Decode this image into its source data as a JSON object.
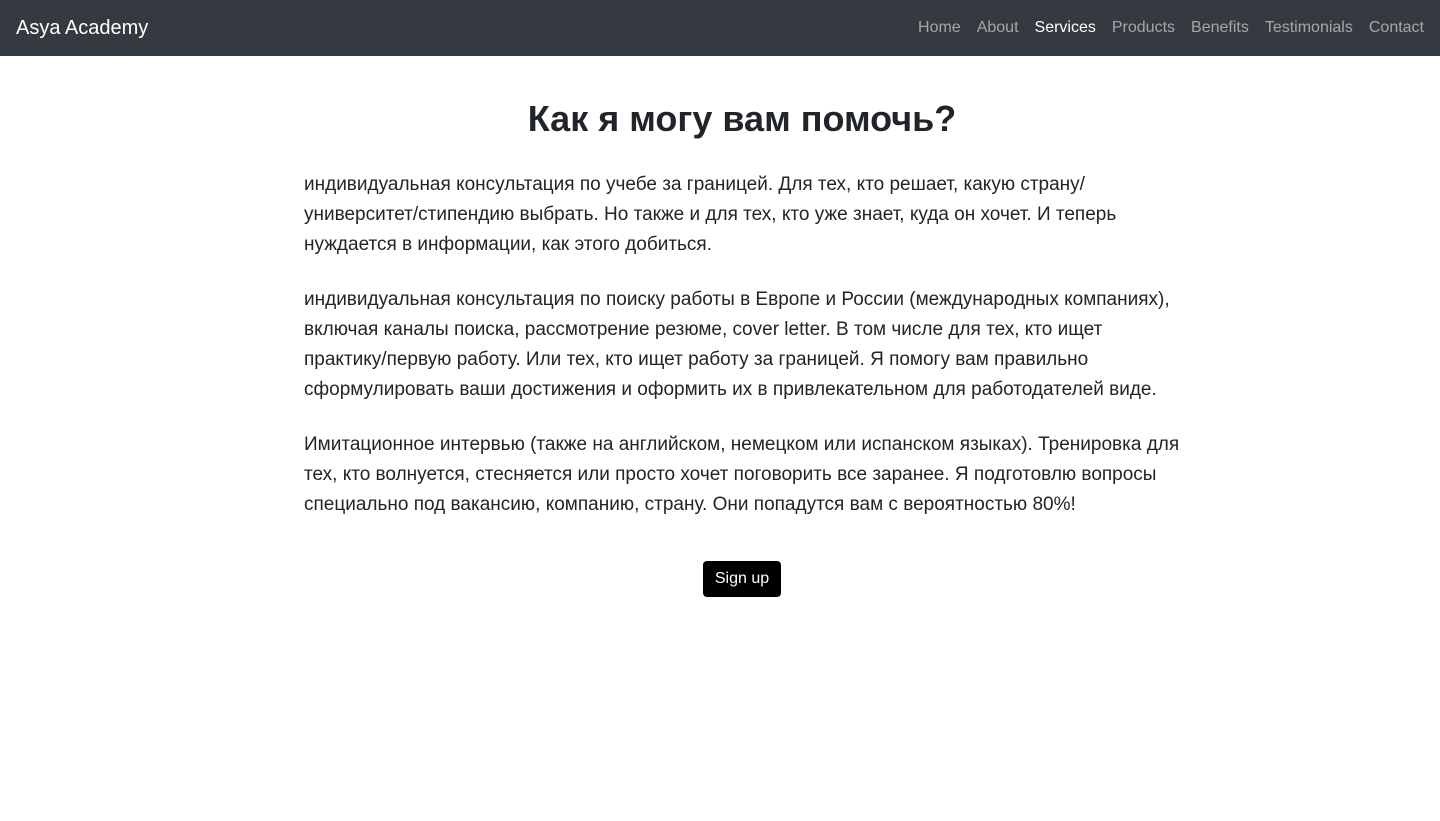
{
  "navbar": {
    "brand": "Asya Academy",
    "links": [
      {
        "label": "Home",
        "active": false
      },
      {
        "label": "About",
        "active": false
      },
      {
        "label": "Services",
        "active": true
      },
      {
        "label": "Products",
        "active": false
      },
      {
        "label": "Benefits",
        "active": false
      },
      {
        "label": "Testimonials",
        "active": false
      },
      {
        "label": "Contact",
        "active": false
      }
    ]
  },
  "main": {
    "heading": "Как я могу вам помочь?",
    "paragraphs": [
      "индивидуальная консультация по учебе за границей. Для тех, кто решает, какую страну/университет/стипендию выбрать. Но также и для тех, кто уже знает, куда он хочет. И теперь нуждается в информации, как этого добиться.",
      "индивидуальная консультация по поиску работы в Европе и России (международных компаниях), включая каналы поиска, рассмотрение резюме, cover letter. В том числе для тех, кто ищет практику/первую работу. Или тех, кто ищет работу за границей. Я помогу вам правильно сформулировать ваши достижения и оформить их в привлекательном для работодателей виде.",
      "Имитационное интервью (также на английском, немецком или испанском языках). Тренировка для тех, кто волнуется, стесняется или просто хочет поговорить все заранее. Я подготовлю вопросы специально под вакансию, компанию, страну. Они попадутся вам с вероятностью 80%!"
    ],
    "signup_label": "Sign up"
  },
  "colors": {
    "navbar_bg": "#343a40",
    "button_bg": "#000000",
    "text": "#212529"
  }
}
